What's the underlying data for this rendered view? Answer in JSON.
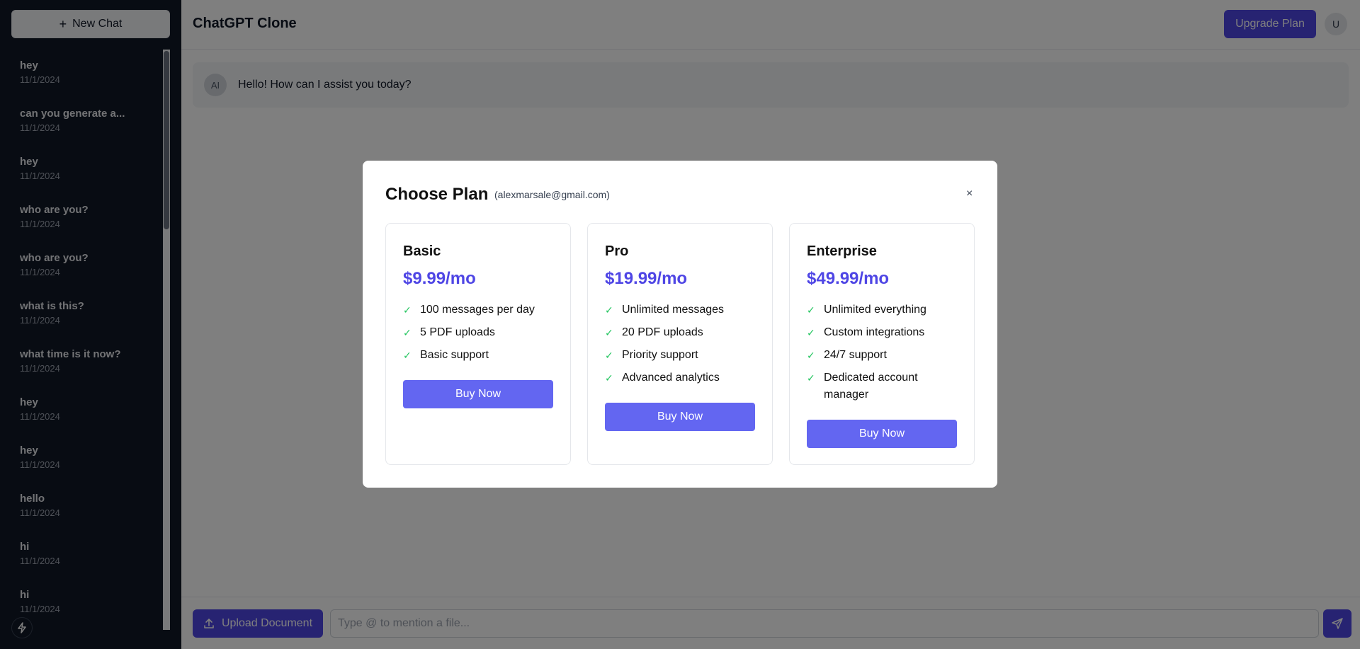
{
  "sidebar": {
    "new_chat_label": "New Chat",
    "chats": [
      {
        "title": "hey",
        "date": "11/1/2024"
      },
      {
        "title": "can you generate a...",
        "date": "11/1/2024"
      },
      {
        "title": "hey",
        "date": "11/1/2024"
      },
      {
        "title": "who are you?",
        "date": "11/1/2024"
      },
      {
        "title": "who are you?",
        "date": "11/1/2024"
      },
      {
        "title": "what is this?",
        "date": "11/1/2024"
      },
      {
        "title": "what time is it now?",
        "date": "11/1/2024"
      },
      {
        "title": "hey",
        "date": "11/1/2024"
      },
      {
        "title": "hey",
        "date": "11/1/2024"
      },
      {
        "title": "hello",
        "date": "11/1/2024"
      },
      {
        "title": "hi",
        "date": "11/1/2024"
      },
      {
        "title": "hi",
        "date": "11/1/2024"
      }
    ],
    "bottom_icon": "bolt-icon"
  },
  "header": {
    "title": "ChatGPT Clone",
    "upgrade_label": "Upgrade Plan",
    "avatar_initial": "U"
  },
  "messages": [
    {
      "avatar": "AI",
      "text": "Hello! How can I assist you today?"
    }
  ],
  "composer": {
    "upload_label": "Upload Document",
    "placeholder": "Type @ to mention a file..."
  },
  "modal": {
    "title": "Choose Plan",
    "email": "(alexmarsale@gmail.com)",
    "close_label": "×",
    "plans": [
      {
        "name": "Basic",
        "price": "$9.99/mo",
        "features": [
          "100 messages per day",
          "5 PDF uploads",
          "Basic support"
        ],
        "button": "Buy Now"
      },
      {
        "name": "Pro",
        "price": "$19.99/mo",
        "features": [
          "Unlimited messages",
          "20 PDF uploads",
          "Priority support",
          "Advanced analytics"
        ],
        "button": "Buy Now"
      },
      {
        "name": "Enterprise",
        "price": "$49.99/mo",
        "features": [
          "Unlimited everything",
          "Custom integrations",
          "24/7 support",
          "Dedicated account manager"
        ],
        "button": "Buy Now"
      }
    ]
  },
  "colors": {
    "accent": "#4f46e5",
    "buy_button": "#6366f1",
    "check": "#22c55e",
    "sidebar_bg": "#111827"
  }
}
